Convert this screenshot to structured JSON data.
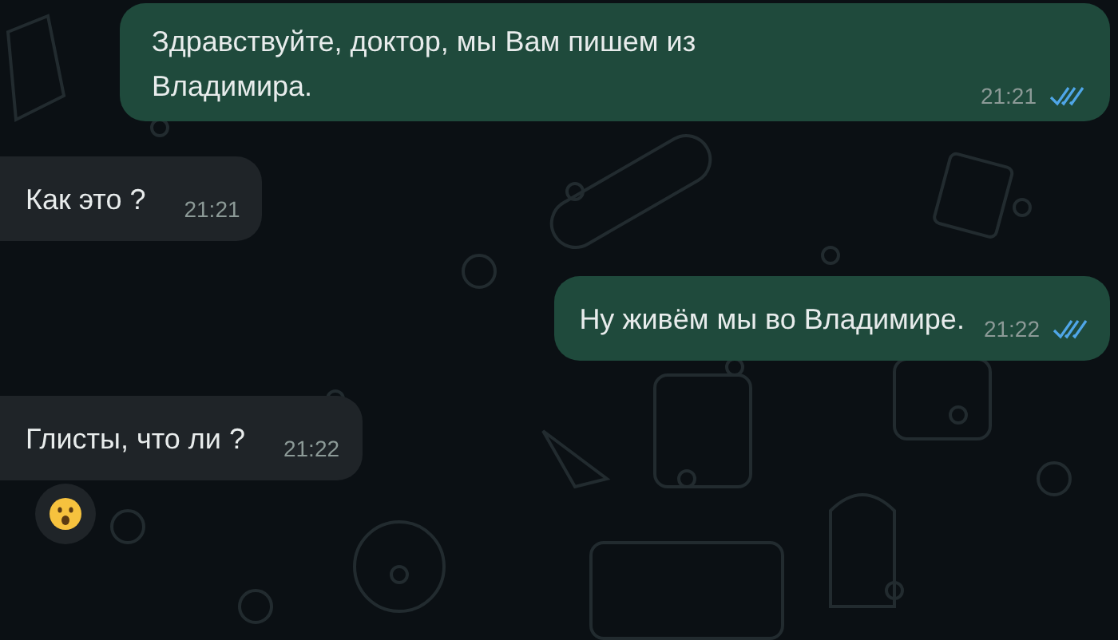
{
  "messages": [
    {
      "kind": "outgoing",
      "text": "Здравствуйте, доктор, мы Вам пишем из Владимира.",
      "time": "21:21",
      "read": true,
      "has_reaction": false
    },
    {
      "kind": "incoming",
      "text": "Как это ?",
      "time": "21:21",
      "has_reaction": false
    },
    {
      "kind": "outgoing",
      "text": "Ну живём мы во Владимире.",
      "time": "21:22",
      "read": true,
      "has_reaction": false
    },
    {
      "kind": "incoming",
      "text": "Глисты, что ли ?",
      "time": "21:22",
      "has_reaction": true
    }
  ]
}
